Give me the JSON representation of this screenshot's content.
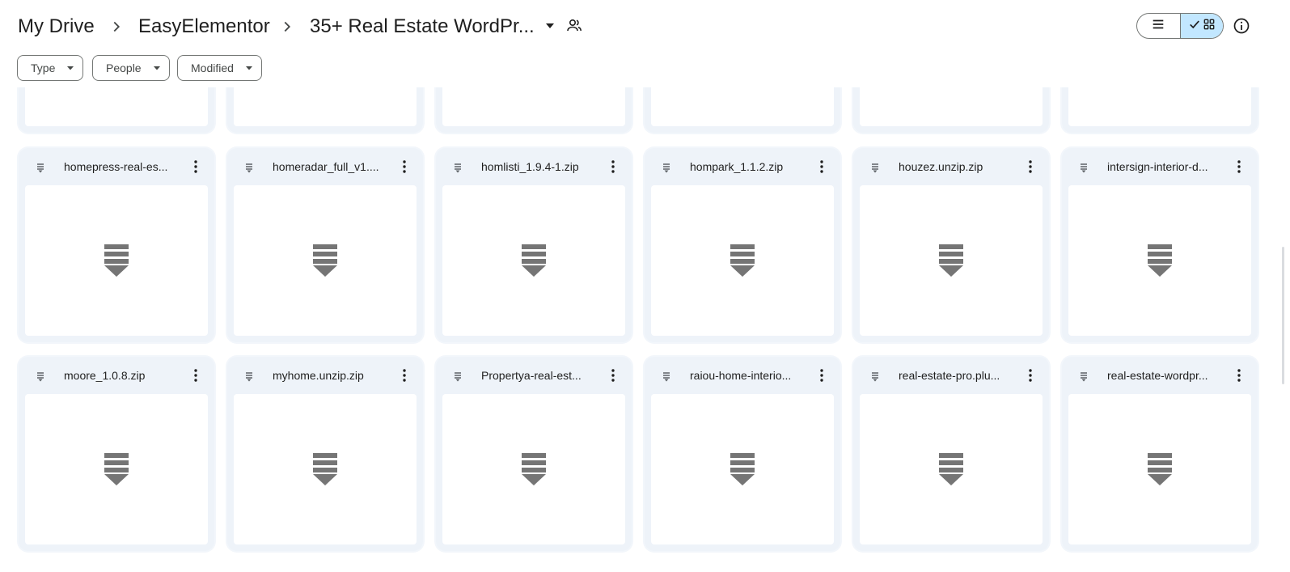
{
  "breadcrumb": {
    "items": [
      "My Drive",
      "EasyElementor",
      "35+ Real Estate WordPr..."
    ]
  },
  "icons": {
    "separator": "chevron-right-icon",
    "folder_menu": "arrow-drop-down-icon",
    "shared": "people-icon",
    "list_view": "list-icon",
    "grid_view": "grid-icon",
    "checked": "check-icon",
    "info": "info-icon",
    "more": "more-vert-icon",
    "zip": "zip-icon"
  },
  "filters": [
    {
      "label": "Type"
    },
    {
      "label": "People"
    },
    {
      "label": "Modified"
    }
  ],
  "files_row_1": [
    {
      "name": "homepress-real-es..."
    },
    {
      "name": "homeradar_full_v1...."
    },
    {
      "name": "homlisti_1.9.4-1.zip"
    },
    {
      "name": "hompark_1.1.2.zip"
    },
    {
      "name": "houzez.unzip.zip"
    },
    {
      "name": "intersign-interior-d..."
    }
  ],
  "files_row_2": [
    {
      "name": "moore_1.0.8.zip"
    },
    {
      "name": "myhome.unzip.zip"
    },
    {
      "name": "Propertya-real-est..."
    },
    {
      "name": "raiou-home-interio..."
    },
    {
      "name": "real-estate-pro.plu..."
    },
    {
      "name": "real-estate-wordpr..."
    }
  ],
  "colors": {
    "card_bg": "#eef3f9",
    "active_toggle": "#c2e7ff",
    "icon_gray": "#757575"
  }
}
